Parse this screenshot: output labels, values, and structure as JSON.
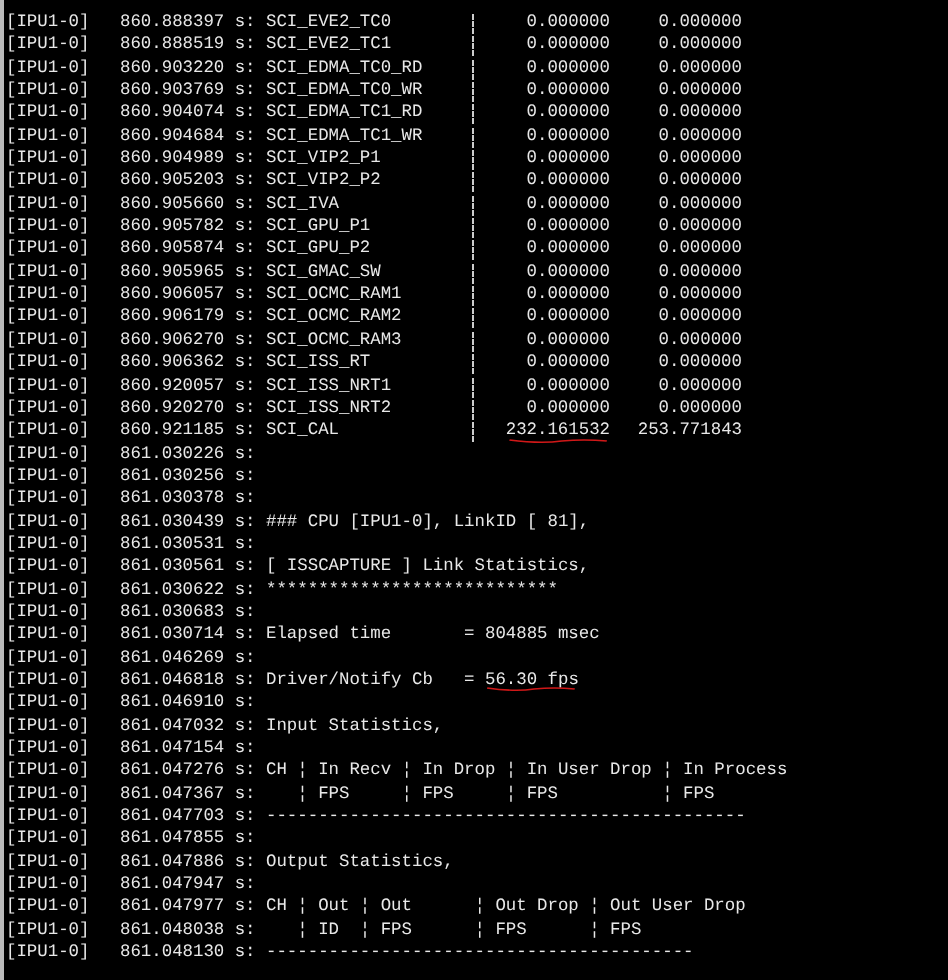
{
  "lines": [
    {
      "kind": "register",
      "source": "[IPU1-0]",
      "time": "860.888397 s:",
      "message": "SCI_EVE2_TC0",
      "values": [
        {
          "text": "0.000000",
          "underlined": false
        },
        {
          "text": "0.000000",
          "underlined": false
        }
      ]
    },
    {
      "kind": "register",
      "source": "[IPU1-0]",
      "time": "860.888519 s:",
      "message": "SCI_EVE2_TC1",
      "values": [
        {
          "text": "0.000000",
          "underlined": false
        },
        {
          "text": "0.000000",
          "underlined": false
        }
      ]
    },
    {
      "kind": "register",
      "source": "[IPU1-0]",
      "time": "860.903220 s:",
      "message": "SCI_EDMA_TC0_RD",
      "values": [
        {
          "text": "0.000000",
          "underlined": false
        },
        {
          "text": "0.000000",
          "underlined": false
        }
      ]
    },
    {
      "kind": "register",
      "source": "[IPU1-0]",
      "time": "860.903769 s:",
      "message": "SCI_EDMA_TC0_WR",
      "values": [
        {
          "text": "0.000000",
          "underlined": false
        },
        {
          "text": "0.000000",
          "underlined": false
        }
      ]
    },
    {
      "kind": "register",
      "source": "[IPU1-0]",
      "time": "860.904074 s:",
      "message": "SCI_EDMA_TC1_RD",
      "values": [
        {
          "text": "0.000000",
          "underlined": false
        },
        {
          "text": "0.000000",
          "underlined": false
        }
      ]
    },
    {
      "kind": "register",
      "source": "[IPU1-0]",
      "time": "860.904684 s:",
      "message": "SCI_EDMA_TC1_WR",
      "values": [
        {
          "text": "0.000000",
          "underlined": false
        },
        {
          "text": "0.000000",
          "underlined": false
        }
      ]
    },
    {
      "kind": "register",
      "source": "[IPU1-0]",
      "time": "860.904989 s:",
      "message": "SCI_VIP2_P1",
      "values": [
        {
          "text": "0.000000",
          "underlined": false
        },
        {
          "text": "0.000000",
          "underlined": false
        }
      ]
    },
    {
      "kind": "register",
      "source": "[IPU1-0]",
      "time": "860.905203 s:",
      "message": "SCI_VIP2_P2",
      "values": [
        {
          "text": "0.000000",
          "underlined": false
        },
        {
          "text": "0.000000",
          "underlined": false
        }
      ]
    },
    {
      "kind": "register",
      "source": "[IPU1-0]",
      "time": "860.905660 s:",
      "message": "SCI_IVA",
      "values": [
        {
          "text": "0.000000",
          "underlined": false
        },
        {
          "text": "0.000000",
          "underlined": false
        }
      ]
    },
    {
      "kind": "register",
      "source": "[IPU1-0]",
      "time": "860.905782 s:",
      "message": "SCI_GPU_P1",
      "values": [
        {
          "text": "0.000000",
          "underlined": false
        },
        {
          "text": "0.000000",
          "underlined": false
        }
      ]
    },
    {
      "kind": "register",
      "source": "[IPU1-0]",
      "time": "860.905874 s:",
      "message": "SCI_GPU_P2",
      "values": [
        {
          "text": "0.000000",
          "underlined": false
        },
        {
          "text": "0.000000",
          "underlined": false
        }
      ]
    },
    {
      "kind": "register",
      "source": "[IPU1-0]",
      "time": "860.905965 s:",
      "message": "SCI_GMAC_SW",
      "values": [
        {
          "text": "0.000000",
          "underlined": false
        },
        {
          "text": "0.000000",
          "underlined": false
        }
      ]
    },
    {
      "kind": "register",
      "source": "[IPU1-0]",
      "time": "860.906057 s:",
      "message": "SCI_OCMC_RAM1",
      "values": [
        {
          "text": "0.000000",
          "underlined": false
        },
        {
          "text": "0.000000",
          "underlined": false
        }
      ]
    },
    {
      "kind": "register",
      "source": "[IPU1-0]",
      "time": "860.906179 s:",
      "message": "SCI_OCMC_RAM2",
      "values": [
        {
          "text": "0.000000",
          "underlined": false
        },
        {
          "text": "0.000000",
          "underlined": false
        }
      ]
    },
    {
      "kind": "register",
      "source": "[IPU1-0]",
      "time": "860.906270 s:",
      "message": "SCI_OCMC_RAM3",
      "values": [
        {
          "text": "0.000000",
          "underlined": false
        },
        {
          "text": "0.000000",
          "underlined": false
        }
      ]
    },
    {
      "kind": "register",
      "source": "[IPU1-0]",
      "time": "860.906362 s:",
      "message": "SCI_ISS_RT",
      "values": [
        {
          "text": "0.000000",
          "underlined": false
        },
        {
          "text": "0.000000",
          "underlined": false
        }
      ]
    },
    {
      "kind": "register",
      "source": "[IPU1-0]",
      "time": "860.920057 s:",
      "message": "SCI_ISS_NRT1",
      "values": [
        {
          "text": "0.000000",
          "underlined": false
        },
        {
          "text": "0.000000",
          "underlined": false
        }
      ]
    },
    {
      "kind": "register",
      "source": "[IPU1-0]",
      "time": "860.920270 s:",
      "message": "SCI_ISS_NRT2",
      "values": [
        {
          "text": "0.000000",
          "underlined": false
        },
        {
          "text": "0.000000",
          "underlined": false
        }
      ]
    },
    {
      "kind": "register",
      "source": "[IPU1-0]",
      "time": "860.921185 s:",
      "message": "SCI_CAL",
      "values": [
        {
          "text": "232.161532",
          "underlined": true
        },
        {
          "text": "253.771843",
          "underlined": false
        }
      ]
    },
    {
      "kind": "log",
      "source": "[IPU1-0]",
      "time": "861.030226 s:"
    },
    {
      "kind": "log",
      "source": "[IPU1-0]",
      "time": "861.030256 s:"
    },
    {
      "kind": "log",
      "source": "[IPU1-0]",
      "time": "861.030378 s:"
    },
    {
      "kind": "log",
      "source": "[IPU1-0]",
      "time": "861.030439 s:",
      "message": "### CPU [IPU1-0], LinkID [ 81],"
    },
    {
      "kind": "log",
      "source": "[IPU1-0]",
      "time": "861.030531 s:"
    },
    {
      "kind": "log",
      "source": "[IPU1-0]",
      "time": "861.030561 s:",
      "message": "[ ISSCAPTURE ] Link Statistics,"
    },
    {
      "kind": "log",
      "source": "[IPU1-0]",
      "time": "861.030622 s:",
      "message": "****************************"
    },
    {
      "kind": "log",
      "source": "[IPU1-0]",
      "time": "861.030683 s:"
    },
    {
      "kind": "log",
      "source": "[IPU1-0]",
      "time": "861.030714 s:",
      "message": "Elapsed time       = 804885 msec"
    },
    {
      "kind": "log",
      "source": "[IPU1-0]",
      "time": "861.046269 s:"
    },
    {
      "kind": "log",
      "source": "[IPU1-0]",
      "time": "861.046818 s:",
      "message": "Driver/Notify Cb   = ",
      "emphasis": "56.30 fps",
      "underlined": true
    },
    {
      "kind": "log",
      "source": "[IPU1-0]",
      "time": "861.046910 s:"
    },
    {
      "kind": "log",
      "source": "[IPU1-0]",
      "time": "861.047032 s:",
      "message": "Input Statistics,"
    },
    {
      "kind": "log",
      "source": "[IPU1-0]",
      "time": "861.047154 s:"
    },
    {
      "kind": "log",
      "source": "[IPU1-0]",
      "time": "861.047276 s:",
      "message": "CH ¦ In Recv ¦ In Drop ¦ In User Drop ¦ In Process"
    },
    {
      "kind": "log",
      "source": "[IPU1-0]",
      "time": "861.047367 s:",
      "message": "   ¦ FPS     ¦ FPS     ¦ FPS          ¦ FPS"
    },
    {
      "kind": "log",
      "source": "[IPU1-0]",
      "time": "861.047703 s:",
      "message": "----------------------------------------------"
    },
    {
      "kind": "log",
      "source": "[IPU1-0]",
      "time": "861.047855 s:"
    },
    {
      "kind": "log",
      "source": "[IPU1-0]",
      "time": "861.047886 s:",
      "message": "Output Statistics,"
    },
    {
      "kind": "log",
      "source": "[IPU1-0]",
      "time": "861.047947 s:"
    },
    {
      "kind": "log",
      "source": "[IPU1-0]",
      "time": "861.047977 s:",
      "message": "CH ¦ Out ¦ Out      ¦ Out Drop ¦ Out User Drop"
    },
    {
      "kind": "log",
      "source": "[IPU1-0]",
      "time": "861.048038 s:",
      "message": "   ¦ ID  ¦ FPS      ¦ FPS      ¦ FPS"
    },
    {
      "kind": "log",
      "source": "[IPU1-0]",
      "time": "861.048130 s:",
      "message": "-----------------------------------------"
    }
  ]
}
